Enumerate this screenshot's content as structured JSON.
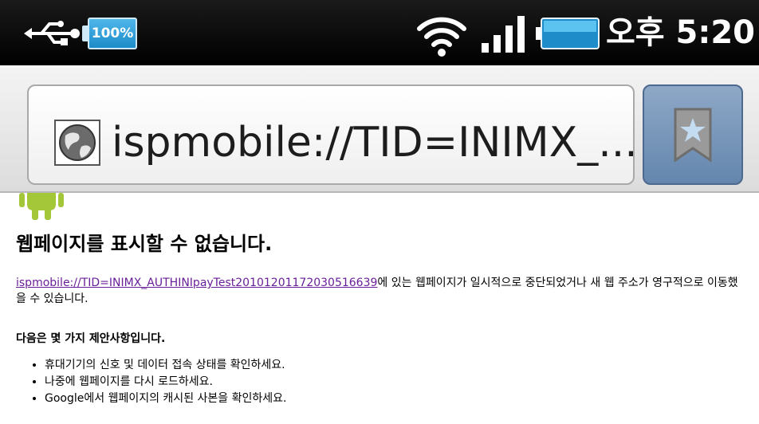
{
  "status_bar": {
    "battery_level": "100%",
    "clock": "오후 5:20",
    "icons": [
      "usb-icon",
      "wifi-icon",
      "signal-icon",
      "battery-icon"
    ]
  },
  "toolbar": {
    "url": "ispmobile://TID=INIMX_...",
    "icons": [
      "globe-icon",
      "bookmark-star-icon"
    ]
  },
  "error_page": {
    "title": "웹페이지를 표시할 수 없습니다.",
    "link_text": "ispmobile://TID=INIMX_AUTHINIpayTest20101201172030516639",
    "description": "에 있는 웹페이지가 일시적으로 중단되었거나 새 웹 주소가 영구적으로 이동했을 수 있습니다.",
    "suggestions_heading": "다음은 몇 가지 제안사항입니다.",
    "suggestions": [
      "휴대기기의 신호 및 데이터 접속 상태를 확인하세요.",
      "나중에 웹페이지를 다시 로드하세요.",
      "Google에서 웹페이지의 캐시된 사본을 확인하세요."
    ]
  },
  "colors": {
    "status_bar_bg": "#000000",
    "battery_badge": "#1d8cc9",
    "bookmark_button": "#6486ad",
    "link": "#6a1f9a",
    "android_green": "#a4c639"
  }
}
